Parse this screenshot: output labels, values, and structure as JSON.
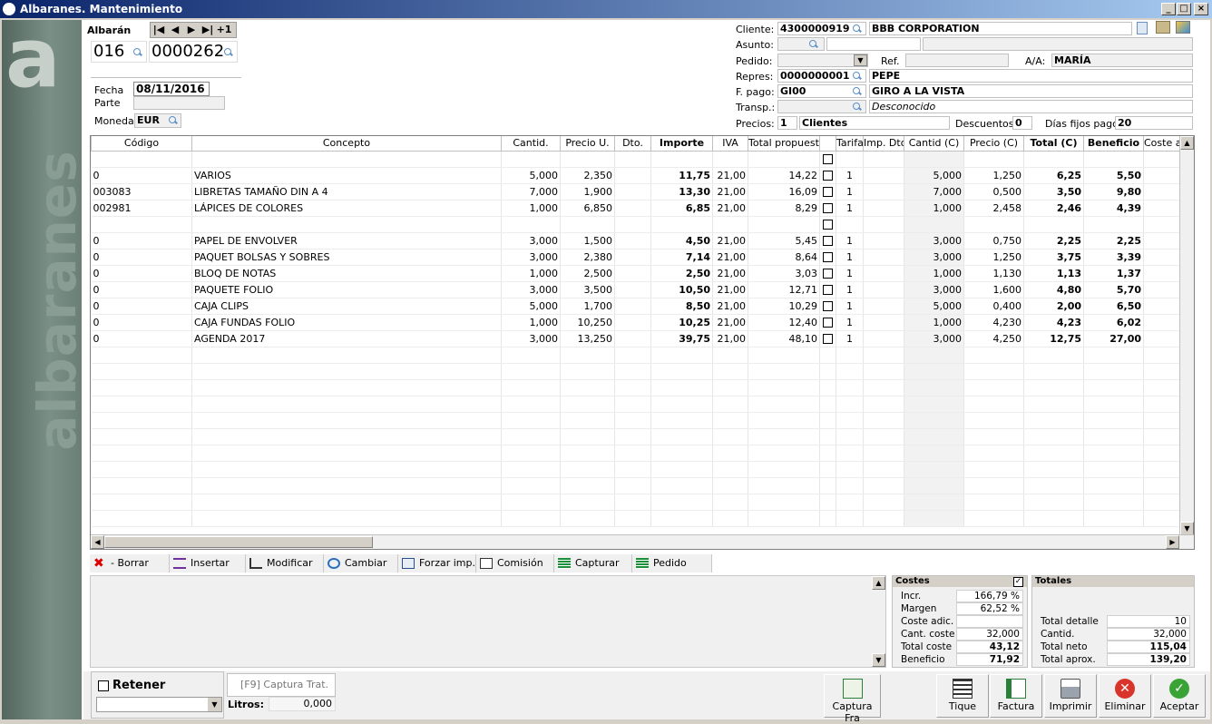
{
  "window": {
    "title": "Albaranes. Mantenimiento"
  },
  "sidebar": {
    "letter": "a",
    "vertical_text": "albaranes"
  },
  "albaran": {
    "label": "Albarán",
    "nav_plus": "+1",
    "serie": "016",
    "numero": "0000262",
    "fecha_label": "Fecha",
    "fecha": "08/11/2016",
    "parte_label": "Parte",
    "parte": "",
    "moneda_label": "Moneda",
    "moneda": "EUR"
  },
  "header": {
    "cliente_label": "Cliente:",
    "cliente_code": "4300000919",
    "cliente_name": "BBB CORPORATION",
    "asunto_label": "Asunto:",
    "pedido_label": "Pedido:",
    "ref_label": "Ref.",
    "aa_label": "A/A:",
    "aa_value": "MARÍA",
    "repres_label": "Repres:",
    "repres_code": "0000000001",
    "repres_name": "PEPE",
    "fpago_label": "F. pago:",
    "fpago_code": "GI00",
    "fpago_name": "GIRO A LA VISTA",
    "transp_label": "Transp.:",
    "transp_name": "Desconocido",
    "precios_label": "Precios:",
    "precios_code": "1",
    "precios_name": "Clientes",
    "descuentos_label": "Descuentos:",
    "descuentos_value": "0",
    "dias_label": "Días fijos pago:",
    "dias_value": "20"
  },
  "grid": {
    "columns": [
      "Código",
      "Concepto",
      "Cantid.",
      "Precio U.",
      "Dto.",
      "Importe",
      "IVA",
      "Total propuesto",
      "",
      "Tarifa",
      "Imp. Dto",
      "Cantid (C)",
      "Precio (C)",
      "Total (C)",
      "Beneficio",
      "Coste ad"
    ],
    "rows": [
      {
        "codigo": "",
        "concepto": "",
        "cantid": "",
        "precio": "",
        "dto": "",
        "importe": "",
        "iva": "",
        "total_prop": "",
        "tarifa": "",
        "impdto": "",
        "cantc": "",
        "precioc": "",
        "totalc": "",
        "beneficio": ""
      },
      {
        "codigo": "0",
        "concepto": "VARIOS",
        "cantid": "5,000",
        "precio": "2,350",
        "dto": "",
        "importe": "11,75",
        "iva": "21,00",
        "total_prop": "14,22",
        "tarifa": "1",
        "impdto": "",
        "cantc": "5,000",
        "precioc": "1,250",
        "totalc": "6,25",
        "beneficio": "5,50"
      },
      {
        "codigo": "003083",
        "concepto": "LIBRETAS  TAMAÑO DIN A 4",
        "cantid": "7,000",
        "precio": "1,900",
        "dto": "",
        "importe": "13,30",
        "iva": "21,00",
        "total_prop": "16,09",
        "tarifa": "1",
        "impdto": "",
        "cantc": "7,000",
        "precioc": "0,500",
        "totalc": "3,50",
        "beneficio": "9,80"
      },
      {
        "codigo": "002981",
        "concepto": "LÁPICES DE COLORES",
        "cantid": "1,000",
        "precio": "6,850",
        "dto": "",
        "importe": "6,85",
        "iva": "21,00",
        "total_prop": "8,29",
        "tarifa": "1",
        "impdto": "",
        "cantc": "1,000",
        "precioc": "2,458",
        "totalc": "2,46",
        "beneficio": "4,39"
      },
      {
        "codigo": "",
        "concepto": "",
        "cantid": "",
        "precio": "",
        "dto": "",
        "importe": "",
        "iva": "",
        "total_prop": "",
        "tarifa": "",
        "impdto": "",
        "cantc": "",
        "precioc": "",
        "totalc": "",
        "beneficio": ""
      },
      {
        "codigo": "0",
        "concepto": "PAPEL DE ENVOLVER",
        "cantid": "3,000",
        "precio": "1,500",
        "dto": "",
        "importe": "4,50",
        "iva": "21,00",
        "total_prop": "5,45",
        "tarifa": "1",
        "impdto": "",
        "cantc": "3,000",
        "precioc": "0,750",
        "totalc": "2,25",
        "beneficio": "2,25"
      },
      {
        "codigo": "0",
        "concepto": "PAQUET BOLSAS Y SOBRES",
        "cantid": "3,000",
        "precio": "2,380",
        "dto": "",
        "importe": "7,14",
        "iva": "21,00",
        "total_prop": "8,64",
        "tarifa": "1",
        "impdto": "",
        "cantc": "3,000",
        "precioc": "1,250",
        "totalc": "3,75",
        "beneficio": "3,39"
      },
      {
        "codigo": "0",
        "concepto": "BLOQ DE NOTAS",
        "cantid": "1,000",
        "precio": "2,500",
        "dto": "",
        "importe": "2,50",
        "iva": "21,00",
        "total_prop": "3,03",
        "tarifa": "1",
        "impdto": "",
        "cantc": "1,000",
        "precioc": "1,130",
        "totalc": "1,13",
        "beneficio": "1,37"
      },
      {
        "codigo": "0",
        "concepto": "PAQUETE FOLIO",
        "cantid": "3,000",
        "precio": "3,500",
        "dto": "",
        "importe": "10,50",
        "iva": "21,00",
        "total_prop": "12,71",
        "tarifa": "1",
        "impdto": "",
        "cantc": "3,000",
        "precioc": "1,600",
        "totalc": "4,80",
        "beneficio": "5,70"
      },
      {
        "codigo": "0",
        "concepto": "CAJA CLIPS",
        "cantid": "5,000",
        "precio": "1,700",
        "dto": "",
        "importe": "8,50",
        "iva": "21,00",
        "total_prop": "10,29",
        "tarifa": "1",
        "impdto": "",
        "cantc": "5,000",
        "precioc": "0,400",
        "totalc": "2,00",
        "beneficio": "6,50"
      },
      {
        "codigo": "0",
        "concepto": "CAJA FUNDAS FOLIO",
        "cantid": "1,000",
        "precio": "10,250",
        "dto": "",
        "importe": "10,25",
        "iva": "21,00",
        "total_prop": "12,40",
        "tarifa": "1",
        "impdto": "",
        "cantc": "1,000",
        "precioc": "4,230",
        "totalc": "4,23",
        "beneficio": "6,02"
      },
      {
        "codigo": "0",
        "concepto": "AGENDA 2017",
        "cantid": "3,000",
        "precio": "13,250",
        "dto": "",
        "importe": "39,75",
        "iva": "21,00",
        "total_prop": "48,10",
        "tarifa": "1",
        "impdto": "",
        "cantc": "3,000",
        "precioc": "4,250",
        "totalc": "12,75",
        "beneficio": "27,00"
      }
    ]
  },
  "actions": {
    "borrar": "- Borrar",
    "insertar": "Insertar",
    "modificar": "Modificar",
    "cambiar": "Cambiar",
    "forzar": "Forzar imp.",
    "comision": "Comisión",
    "capturar": "Capturar",
    "pedido": "Pedido"
  },
  "costes": {
    "title": "Costes",
    "incr_label": "Incr.",
    "incr": "166,79 %",
    "margen_label": "Margen",
    "margen": "62,52 %",
    "coste_adic_label": "Coste adic.",
    "coste_adic": "",
    "cant_coste_label": "Cant. coste",
    "cant_coste": "32,000",
    "total_coste_label": "Total coste",
    "total_coste": "43,12",
    "beneficio_label": "Beneficio",
    "beneficio": "71,92"
  },
  "totales": {
    "title": "Totales",
    "detalle_label": "Total detalle",
    "detalle": "10",
    "cantid_label": "Cantid.",
    "cantid": "32,000",
    "neto_label": "Total neto",
    "neto": "115,04",
    "aprox_label": "Total aprox.",
    "aprox": "139,20"
  },
  "footer": {
    "retener": "Retener",
    "captura_trat": "[F9] Captura Trat.",
    "litros_label": "Litros:",
    "litros": "0,000",
    "captura_fra": "Captura Fra",
    "tique": "Tique",
    "factura": "Factura",
    "imprimir": "Imprimir",
    "eliminar": "Eliminar",
    "aceptar": "Aceptar"
  }
}
